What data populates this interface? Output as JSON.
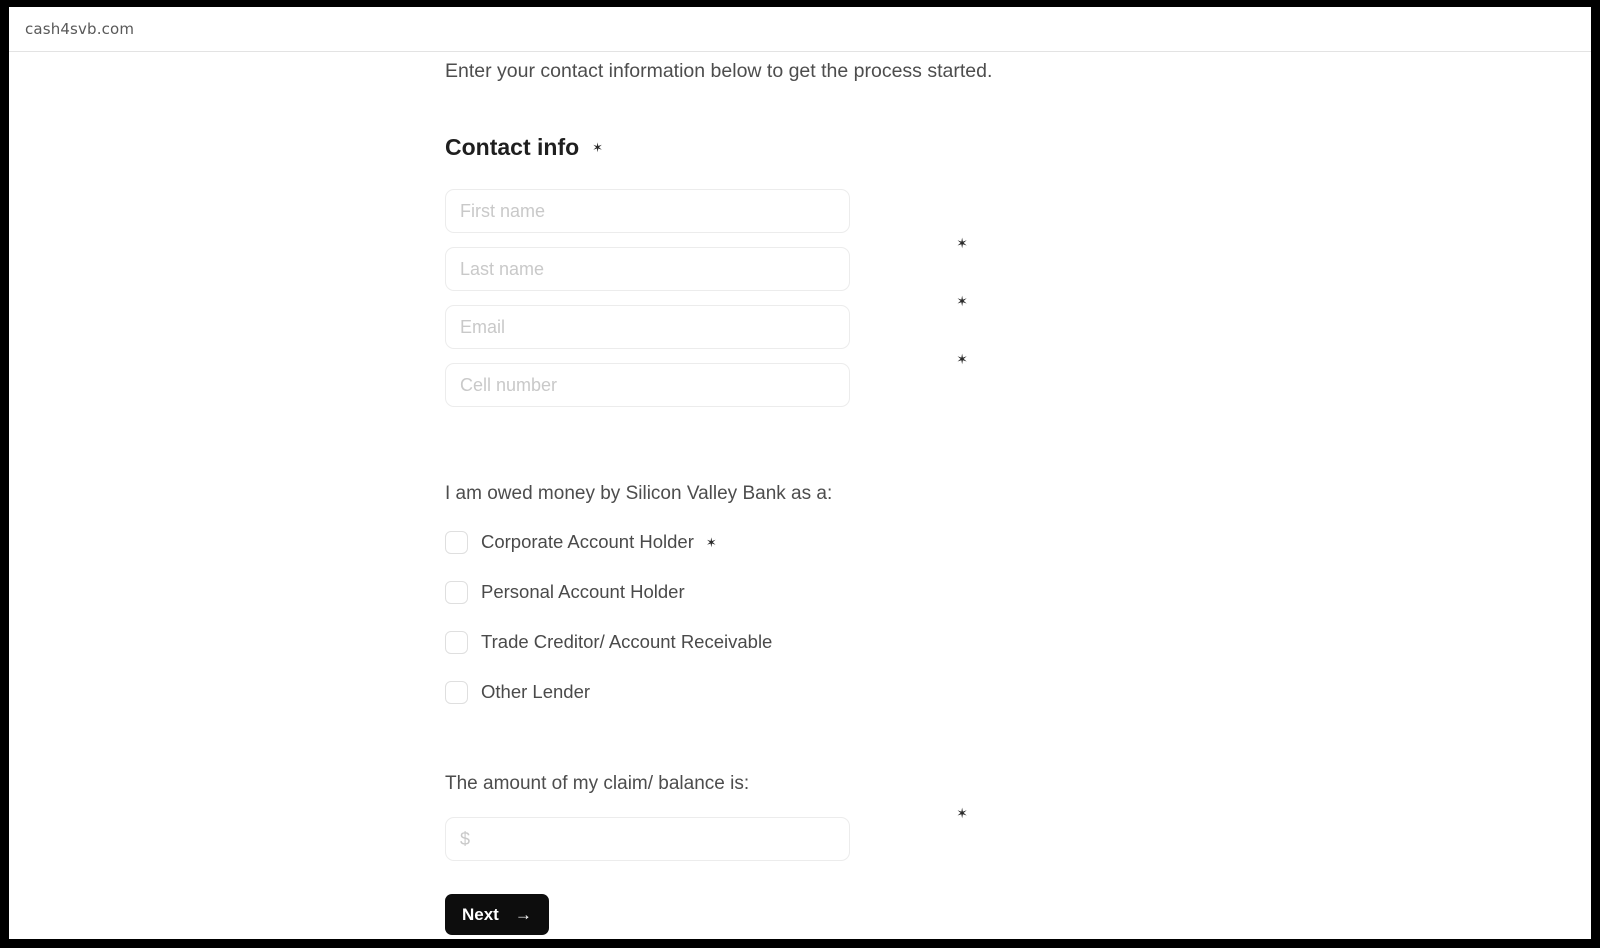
{
  "browser": {
    "url": "cash4svb.com"
  },
  "form": {
    "intro": "Enter your contact information below to get the process started.",
    "section_title": "Contact info",
    "required_marker": "✶",
    "fields": [
      {
        "name": "first-name",
        "placeholder": "First name",
        "value": "",
        "required_star": false
      },
      {
        "name": "last-name",
        "placeholder": "Last name",
        "value": "",
        "required_star": true
      },
      {
        "name": "email",
        "placeholder": "Email",
        "value": "",
        "required_star": true
      },
      {
        "name": "cell-number",
        "placeholder": "Cell number",
        "value": "",
        "required_star": true
      }
    ],
    "claimant_question": "I am owed money by Silicon Valley Bank as a:",
    "claimant_options": [
      {
        "label": "Corporate Account Holder",
        "checked": false,
        "required_star": true
      },
      {
        "label": "Personal Account Holder",
        "checked": false,
        "required_star": false
      },
      {
        "label": "Trade Creditor/ Account Receivable",
        "checked": false,
        "required_star": false
      },
      {
        "label": "Other Lender",
        "checked": false,
        "required_star": false
      }
    ],
    "amount_question": "The amount of my claim/ balance is:",
    "amount_field": {
      "placeholder": "$",
      "value": "",
      "required_star": true
    },
    "next_button": {
      "label": "Next",
      "arrow": "→"
    }
  },
  "colors": {
    "frame": "#000000",
    "page_bg": "#ffffff",
    "text": "#4d4d4d",
    "heading": "#1f1f1f",
    "placeholder": "#c9c9c9",
    "input_border": "#ececec",
    "button_bg": "#0d0d0d",
    "button_text": "#ffffff"
  }
}
